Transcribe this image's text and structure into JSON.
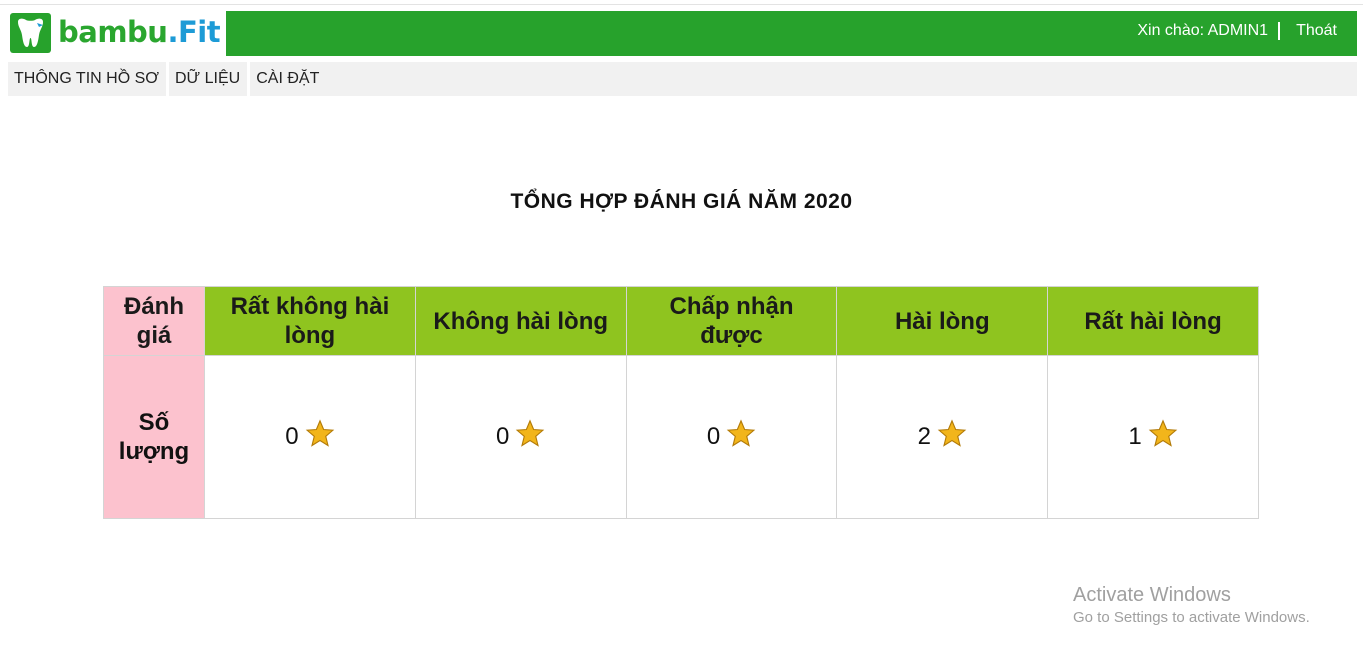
{
  "logo": {
    "part1": "bambu",
    "part2": ".Fit"
  },
  "header": {
    "greeting": "Xin chào: ADMIN1",
    "logout_label": "Thoát"
  },
  "menu": {
    "items": [
      "THÔNG TIN HỒ SƠ",
      "DỮ LIỆU",
      "CÀI ĐẶT"
    ]
  },
  "page_title": "TỔNG HỢP ĐÁNH GIÁ NĂM 2020",
  "table": {
    "header_label": "Đánh giá",
    "row_label": "Số lượng",
    "columns": [
      "Rất không hài lòng",
      "Không hài lòng",
      "Chấp nhận được",
      "Hài lòng",
      "Rất hài lòng"
    ],
    "counts": [
      "0",
      "0",
      "0",
      "2",
      "1"
    ]
  },
  "watermark": {
    "title": "Activate Windows",
    "subtitle": "Go to Settings to activate Windows."
  },
  "colors": {
    "header_green": "#27a22c",
    "table_header_green": "#8fc41f",
    "label_pink": "#fcc2ce",
    "star_gold": "#f2b51b"
  },
  "icons": {
    "star": "star-icon",
    "logo": "tooth-logo-icon"
  }
}
